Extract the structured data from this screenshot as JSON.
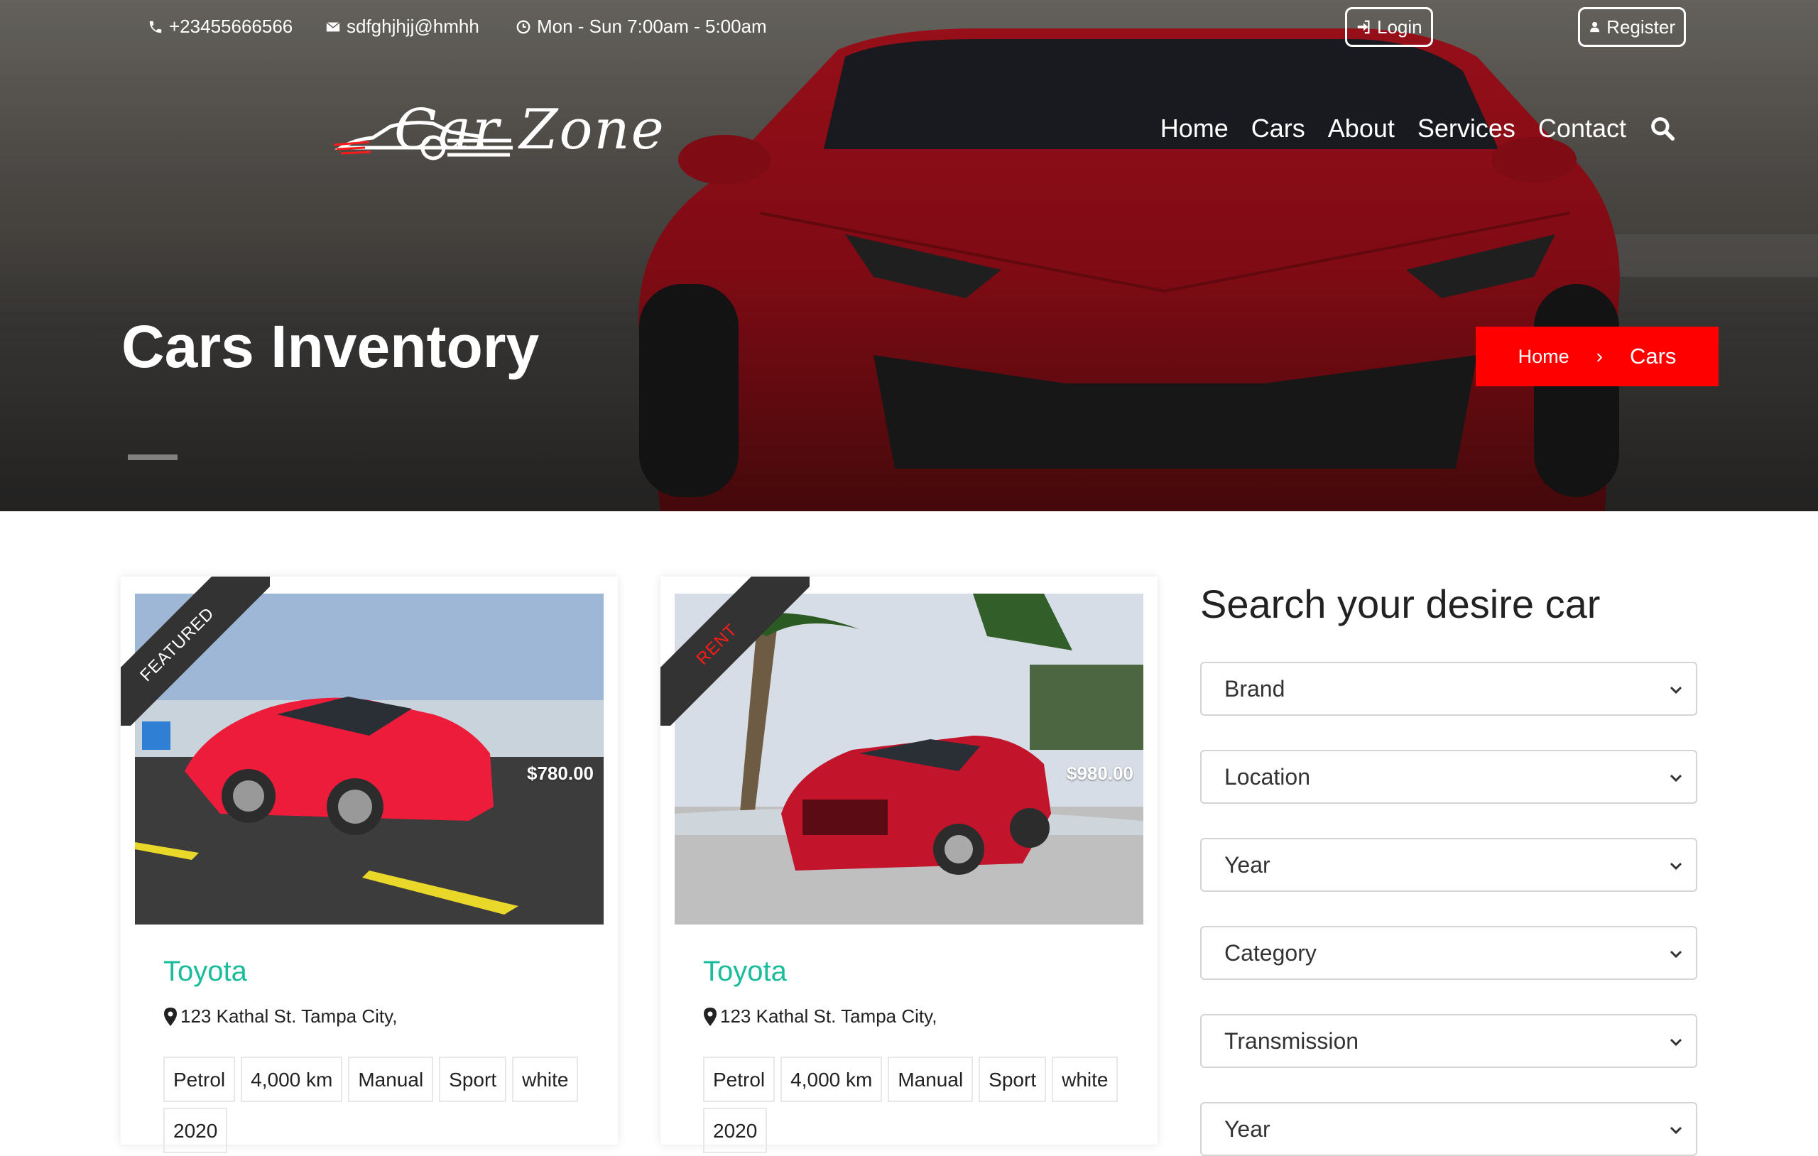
{
  "topbar": {
    "phone": "+23455666566",
    "email": "sdfghjhjj@hmhh",
    "hours": "Mon - Sun 7:00am - 5:00am",
    "login_label": "Login",
    "register_label": "Register"
  },
  "brand": {
    "name": "Car Zone",
    "accent": "#ff0000"
  },
  "nav": {
    "items": [
      {
        "label": "Home"
      },
      {
        "label": "Cars"
      },
      {
        "label": "About"
      },
      {
        "label": "Services"
      },
      {
        "label": "Contact"
      }
    ],
    "search_icon": "search-icon"
  },
  "hero": {
    "title": "Cars Inventory",
    "breadcrumb": {
      "home": "Home",
      "separator": "›",
      "current": "Cars",
      "color": "#ff0000"
    }
  },
  "cars": [
    {
      "badge": "FEATURED",
      "price": "$780.00",
      "title": "Toyota",
      "address": "123 Kathal St. Tampa City,",
      "tags": [
        "Petrol",
        "4,000 km",
        "Manual",
        "Sport",
        "white",
        "2020"
      ]
    },
    {
      "badge": "RENT",
      "price": "$980.00",
      "title": "Toyota",
      "address": "123 Kathal St. Tampa City,",
      "tags": [
        "Petrol",
        "4,000 km",
        "Manual",
        "Sport",
        "white",
        "2020"
      ]
    }
  ],
  "search": {
    "title": "Search your desire car",
    "selects": [
      {
        "label": "Brand"
      },
      {
        "label": "Location"
      },
      {
        "label": "Year"
      },
      {
        "label": "Category"
      },
      {
        "label": "Transmission"
      },
      {
        "label": "Year"
      }
    ]
  },
  "colors": {
    "title_teal": "#1abc9c",
    "accent_red": "#ff0000"
  }
}
